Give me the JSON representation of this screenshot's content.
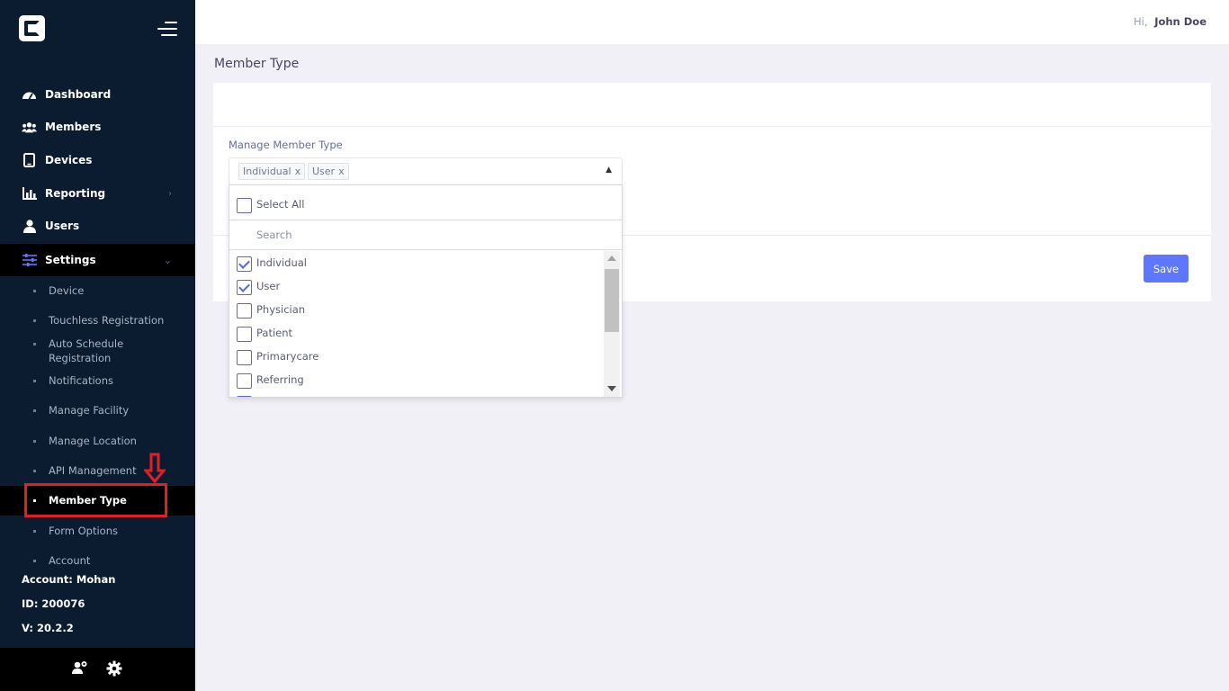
{
  "header": {
    "greeting_prefix": "Hi,",
    "user_name": "John Doe"
  },
  "sidebar": {
    "nav": [
      {
        "label": "Dashboard",
        "icon": "dashboard-gauge-icon"
      },
      {
        "label": "Members",
        "icon": "members-group-icon"
      },
      {
        "label": "Devices",
        "icon": "tablet-device-icon"
      },
      {
        "label": "Reporting",
        "icon": "bar-chart-icon"
      },
      {
        "label": "Users",
        "icon": "user-icon"
      },
      {
        "label": "Settings",
        "icon": "sliders-icon"
      }
    ],
    "settings_sub": [
      {
        "label": "Device"
      },
      {
        "label": "Touchless Registration"
      },
      {
        "label": "Auto Schedule Registration"
      },
      {
        "label": "Notifications"
      },
      {
        "label": "Manage Facility"
      },
      {
        "label": "Manage Location"
      },
      {
        "label": "API Management"
      },
      {
        "label": "Member Type"
      },
      {
        "label": "Form Options"
      },
      {
        "label": "Account"
      }
    ],
    "account": "Account: Mohan",
    "id": "ID: 200076",
    "version": "V: 20.2.2",
    "footer_icons": [
      "user-switch-icon",
      "gear-icon"
    ],
    "accent_color": "#5d78ff"
  },
  "page": {
    "title": "Member Type",
    "field_label": "Manage Member Type",
    "selected_tags": [
      "Individual",
      "User"
    ],
    "dropdown": {
      "select_all": "Select All",
      "search_placeholder": "Search",
      "options": [
        {
          "label": "Individual",
          "checked": true
        },
        {
          "label": "User",
          "checked": true
        },
        {
          "label": "Physician",
          "checked": false
        },
        {
          "label": "Patient",
          "checked": false
        },
        {
          "label": "Primarycare",
          "checked": false
        },
        {
          "label": "Referring",
          "checked": false
        }
      ]
    },
    "save_label": "Save"
  },
  "annotation": {
    "color": "#e31e24",
    "target": "Member Type"
  }
}
